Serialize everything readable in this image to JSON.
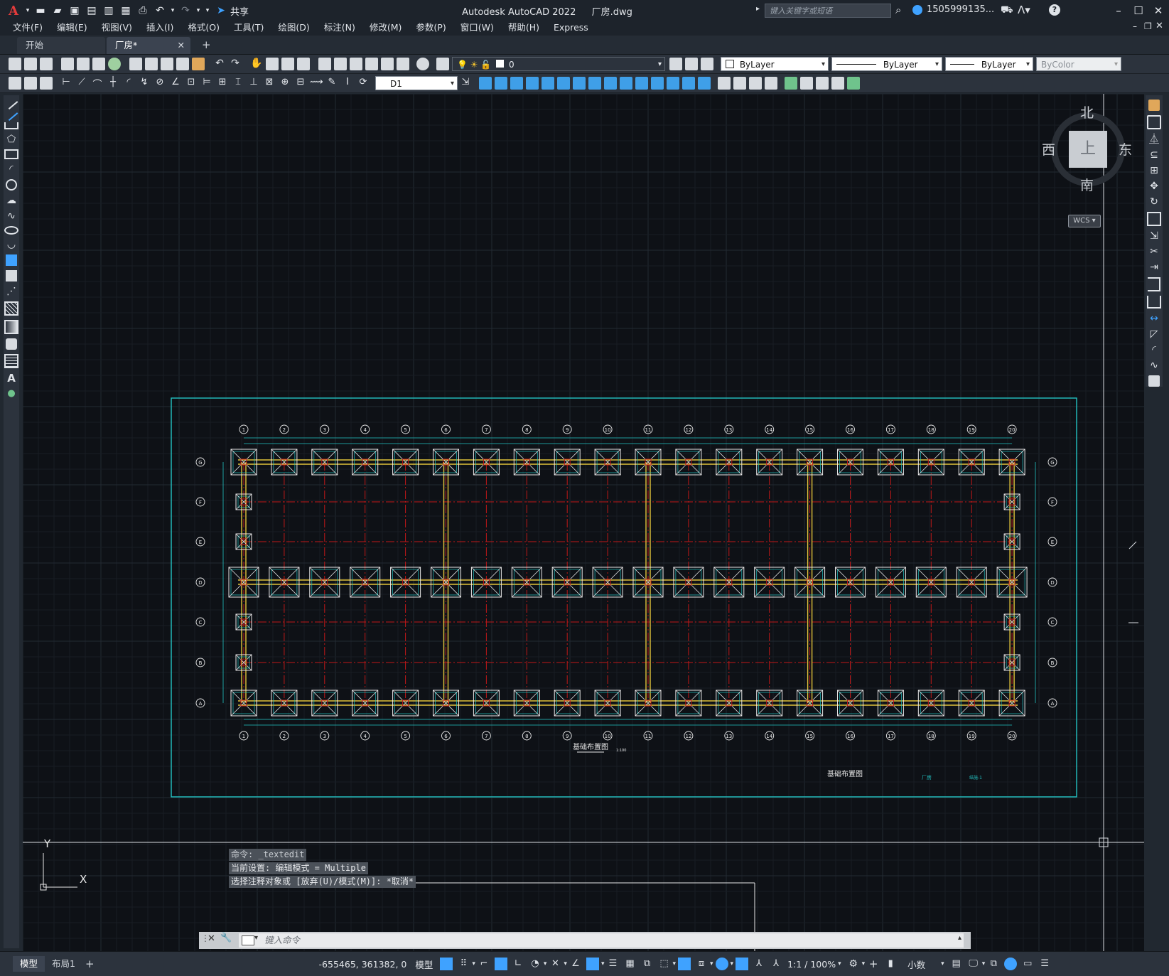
{
  "title_bar": {
    "app_title": "Autodesk AutoCAD 2022",
    "file_name": "厂房.dwg",
    "share_label": "共享",
    "search_placeholder": "键入关键字或短语",
    "user_name": "1505999135..."
  },
  "menu": [
    "文件(F)",
    "编辑(E)",
    "视图(V)",
    "插入(I)",
    "格式(O)",
    "工具(T)",
    "绘图(D)",
    "标注(N)",
    "修改(M)",
    "参数(P)",
    "窗口(W)",
    "帮助(H)",
    "Express"
  ],
  "tabs": [
    {
      "label": "开始",
      "active": false
    },
    {
      "label": "厂房*",
      "active": true
    }
  ],
  "properties": {
    "layer": "0",
    "color": "ByLayer",
    "linetype": "ByLayer",
    "lineweight": "ByLayer",
    "plotstyle": "ByColor",
    "dimstyle": "D1"
  },
  "viewcube": {
    "north": "北",
    "south": "南",
    "east": "东",
    "west": "西",
    "face": "上",
    "ucs": "WCS"
  },
  "drawing": {
    "grid_cols": [
      "1",
      "2",
      "3",
      "4",
      "5",
      "6",
      "7",
      "8",
      "9",
      "10",
      "11",
      "12",
      "13",
      "14",
      "15",
      "16",
      "17",
      "18",
      "19",
      "20"
    ],
    "grid_rows": [
      "G",
      "F",
      "E",
      "D",
      "C",
      "B",
      "A"
    ],
    "plan_title": "基础布置图",
    "plan_scale": "1:100",
    "titleblock_name": "基础布置图",
    "titleblock_project": "厂房",
    "titleblock_no": "结施-1"
  },
  "command": {
    "history": [
      "命令: _textedit",
      "当前设置: 编辑模式 = Multiple",
      "选择注释对象或 [放弃(U)/模式(M)]: *取消*"
    ],
    "placeholder": "键入命令"
  },
  "ucs_icon": {
    "x_label": "X",
    "y_label": "Y"
  },
  "layout_tabs": [
    {
      "label": "模型",
      "active": true
    },
    {
      "label": "布局1",
      "active": false
    }
  ],
  "status": {
    "coordinates": "-655465, 361382, 0",
    "space": "模型",
    "annotation_scale": "1:1 / 100%",
    "units": "小数"
  },
  "colors": {
    "canvas": "#0e1116",
    "cyan": "#22c4c4",
    "yellow": "#e0c23a",
    "red": "#c01818",
    "white": "#e8e8e8"
  }
}
